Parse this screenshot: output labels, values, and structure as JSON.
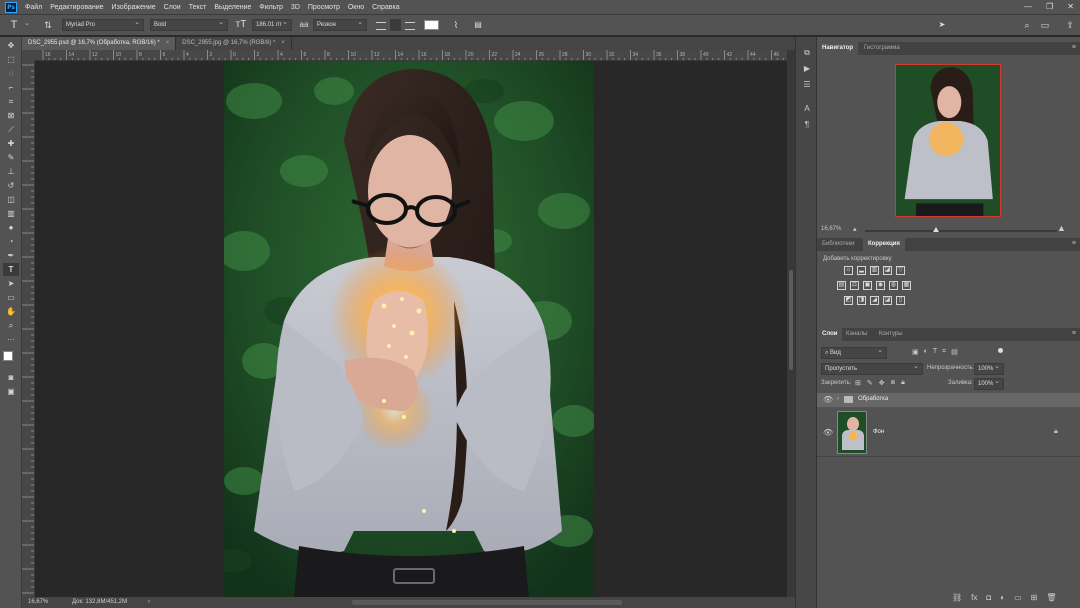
{
  "app": {
    "logo": "Ps",
    "menu": [
      "Файл",
      "Редактирование",
      "Изображение",
      "Слои",
      "Текст",
      "Выделение",
      "Фильтр",
      "3D",
      "Просмотр",
      "Окно",
      "Справка"
    ],
    "window_controls": [
      "—",
      "❐",
      "✕"
    ]
  },
  "options": {
    "font_family": "Myriad Pro",
    "font_style": "Bold",
    "font_size": "186.01 пт",
    "antialias": "Резкое",
    "color_swatch": "#ffffff"
  },
  "tabs": [
    {
      "label": "DSC_2955.psd @ 16,7% (Обработка, RGB/16) *",
      "active": true
    },
    {
      "label": "DSC_2955.jpg @ 16,7% (RGB/8) *",
      "active": false
    }
  ],
  "ruler": {
    "h_labels": [
      "16",
      "14",
      "12",
      "10",
      "8",
      "6",
      "4",
      "2",
      "0",
      "2",
      "4",
      "6",
      "8",
      "10",
      "12",
      "14",
      "16",
      "18",
      "20",
      "22",
      "24",
      "26",
      "28",
      "30",
      "32",
      "34",
      "36",
      "38",
      "40",
      "42",
      "44",
      "46"
    ]
  },
  "status": {
    "zoom": "16,67%",
    "doc": "Док: 132,8M/451,2M",
    "arrow": "›"
  },
  "navigator": {
    "tabs": [
      "Навигатор",
      "Гистограмма"
    ],
    "zoom": "16,67%"
  },
  "adjustments": {
    "tabs": [
      "Библиотеки",
      "Коррекция"
    ],
    "hint": "Добавить корректировку"
  },
  "layers": {
    "tabs": [
      "Слои",
      "Каналы",
      "Контуры"
    ],
    "filter_label": "Вид",
    "blend_mode": "Пропустить",
    "opacity_label": "Непрозрачность:",
    "opacity_value": "100%",
    "lock_label": "Закрепить:",
    "fill_label": "Заливка:",
    "fill_value": "100%",
    "items": [
      {
        "name": "Обработка",
        "type": "group"
      },
      {
        "name": "Фон",
        "type": "image"
      }
    ]
  },
  "colors": {
    "ui_dark": "#535353",
    "canvas_bg": "#282828",
    "accent_red": "#d23b2b",
    "selection": "#5c5c5c"
  }
}
